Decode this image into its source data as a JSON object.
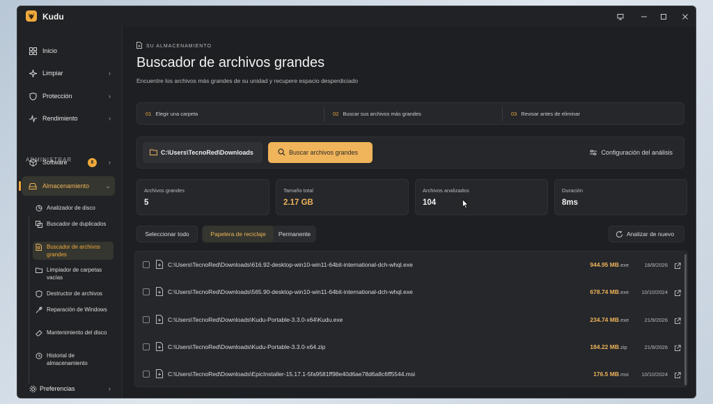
{
  "app": {
    "title": "Kudu"
  },
  "sidebar": {
    "items": [
      {
        "label": "Inicio",
        "icon": "grid-icon"
      },
      {
        "label": "Limpiar",
        "icon": "sparkle-icon"
      },
      {
        "label": "Protección",
        "icon": "shield-icon"
      },
      {
        "label": "Rendimiento",
        "icon": "pulse-icon"
      }
    ],
    "section": "ADMINISTRAR",
    "software": {
      "label": "Software",
      "badge": "8"
    },
    "storage": {
      "label": "Almacenamiento"
    },
    "storage_items": [
      {
        "label": "Analizador de disco"
      },
      {
        "label": "Buscador de duplicados"
      },
      {
        "label": "Buscador de archivos grandes"
      },
      {
        "label": "Limpiador de carpetas vacías"
      },
      {
        "label": "Destructor de archivos"
      },
      {
        "label": "Reparación de Windows"
      },
      {
        "label": "Mantenimiento del disco"
      },
      {
        "label": "Historial de almacenamiento"
      }
    ],
    "preferences": {
      "label": "Preferencias"
    }
  },
  "header": {
    "breadcrumb": "SU ALMACENAMIENTO",
    "title": "Buscador de archivos grandes",
    "subtitle": "Encuentre los archivos más grandes de su unidad y recupere espacio desperdiciado"
  },
  "steps": [
    {
      "num": "01",
      "label": "Elegir una carpeta"
    },
    {
      "num": "02",
      "label": "Buscar sus archivos más grandes"
    },
    {
      "num": "03",
      "label": "Revisar antes de eliminar"
    }
  ],
  "toolbar": {
    "path": "C:\\Users\\TecnoRed\\Downloads",
    "search_label": "Buscar archivos grandes",
    "config_label": "Configuración del análisis"
  },
  "stats": [
    {
      "label": "Archivos grandes",
      "value": "5"
    },
    {
      "label": "Tamaño total",
      "value": "2.17 GB"
    },
    {
      "label": "Archivos analizados",
      "value": "104"
    },
    {
      "label": "Duración",
      "value": "8ms"
    }
  ],
  "actions": {
    "select_all": "Seleccionar todo",
    "tab_recycle": "Papelera de reciclaje",
    "tab_permanent": "Permanente",
    "rescan": "Analizar de nuevo"
  },
  "files": [
    {
      "path": "C:\\Users\\TecnoRed\\Downloads\\616.92-desktop-win10-win11-64bit-international-dch-whql.exe",
      "size": "944.95 MB",
      "ext": ".exe",
      "date": "18/9/2026"
    },
    {
      "path": "C:\\Users\\TecnoRed\\Downloads\\565.90-desktop-win10-win11-64bit-international-dch-whql.exe",
      "size": "678.74 MB",
      "ext": ".exe",
      "date": "10/10/2024"
    },
    {
      "path": "C:\\Users\\TecnoRed\\Downloads\\Kudu-Portable-3.3.0-x64\\Kudu.exe",
      "size": "234.74 MB",
      "ext": ".exe",
      "date": "21/9/2026"
    },
    {
      "path": "C:\\Users\\TecnoRed\\Downloads\\Kudu-Portable-3.3.0-x64.zip",
      "size": "184.22 MB",
      "ext": ".zip",
      "date": "21/9/2026"
    },
    {
      "path": "C:\\Users\\TecnoRed\\Downloads\\EpicInstaller-15.17.1-5fa9581ff98e40d6ae78d6a8c6ff5544.msi",
      "size": "176.5 MB",
      "ext": ".msi",
      "date": "10/10/2024"
    }
  ],
  "colors": {
    "accent": "#f0b45a",
    "background": "#1d1f22",
    "panel": "#25272b"
  }
}
